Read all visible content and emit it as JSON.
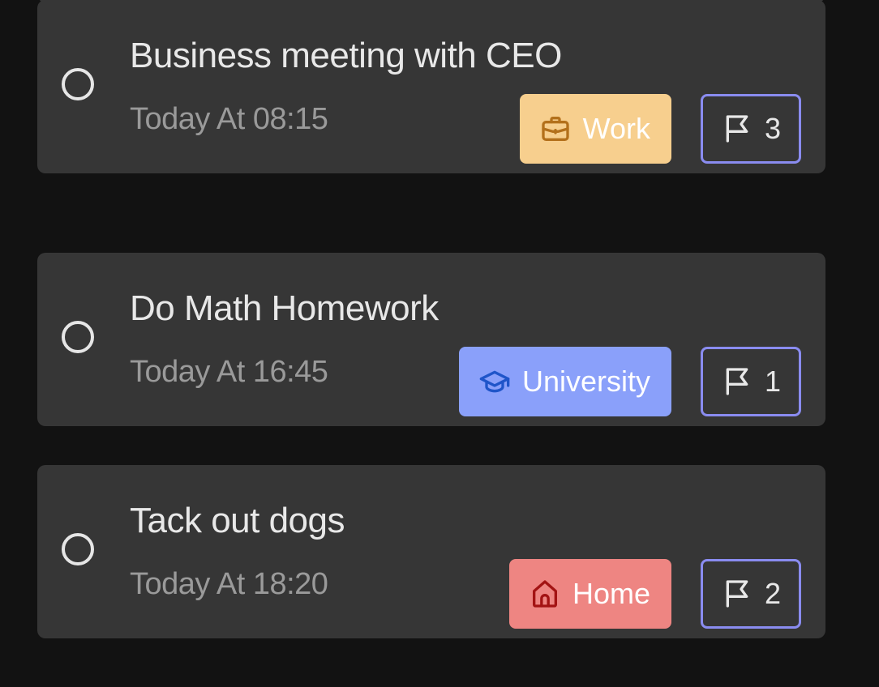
{
  "tasks": [
    {
      "title": "Do Math Homework",
      "time": "Today At 16:45",
      "category": {
        "label": "University",
        "icon": "graduation-cap-icon",
        "bg": "#8AA0FA",
        "fg": "#ffffff",
        "icon_color": "#1f55c9"
      },
      "priority": "1"
    },
    {
      "title": "Tack out dogs",
      "time": "Today At 18:20",
      "category": {
        "label": "Home",
        "icon": "house-icon",
        "bg": "#EE8582",
        "fg": "#ffffff",
        "icon_color": "#a31313"
      },
      "priority": "2"
    },
    {
      "title": "Business meeting with CEO",
      "time": "Today At 08:15",
      "category": {
        "label": "Work",
        "icon": "briefcase-icon",
        "bg": "#F7CF8E",
        "fg": "#ffffff",
        "icon_color": "#b3701b"
      },
      "priority": "3"
    }
  ],
  "colors": {
    "background": "#121212",
    "card": "#363636",
    "priority_border": "#8A8CF0",
    "title_text": "#E8E8E8",
    "time_text": "#9A9A9A"
  }
}
